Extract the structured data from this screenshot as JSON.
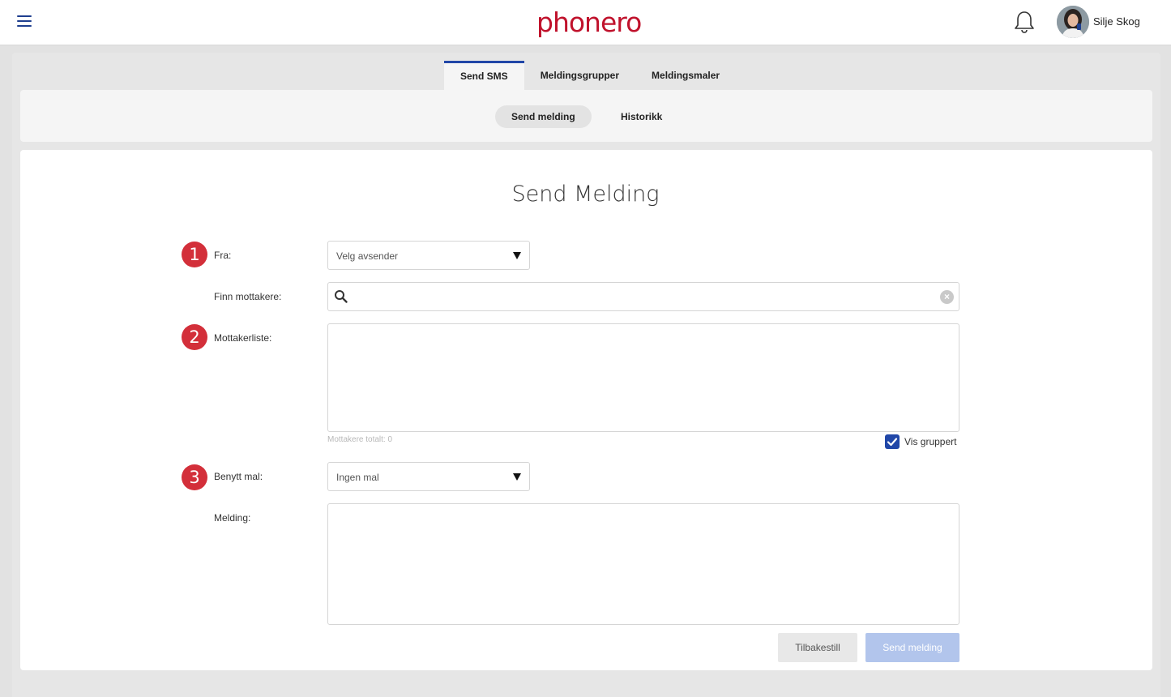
{
  "header": {
    "logo": "phonero",
    "user_name": "Silje Skog",
    "accent_color": "#2147a8",
    "brand_color": "#c0122c"
  },
  "main_tabs": [
    {
      "label": "Send SMS",
      "active": true
    },
    {
      "label": "Meldingsgrupper",
      "active": false
    },
    {
      "label": "Meldingsmaler",
      "active": false
    }
  ],
  "sub_tabs": [
    {
      "label": "Send melding",
      "active": true
    },
    {
      "label": "Historikk",
      "active": false
    }
  ],
  "form": {
    "title": "Send Melding",
    "badges": [
      "1",
      "2",
      "3"
    ],
    "from_label": "Fra:",
    "from_value": "Velg avsender",
    "find_label": "Finn mottakere:",
    "find_value": "",
    "recipients_label": "Mottakerliste:",
    "recipients_total": "Mottakere totalt: 0",
    "group_view_label": "Vis gruppert",
    "group_view_checked": true,
    "template_label": "Benytt mal:",
    "template_value": "Ingen mal",
    "message_label": "Melding:",
    "message_value": ""
  },
  "buttons": {
    "reset": "Tilbakestill",
    "send": "Send melding"
  }
}
